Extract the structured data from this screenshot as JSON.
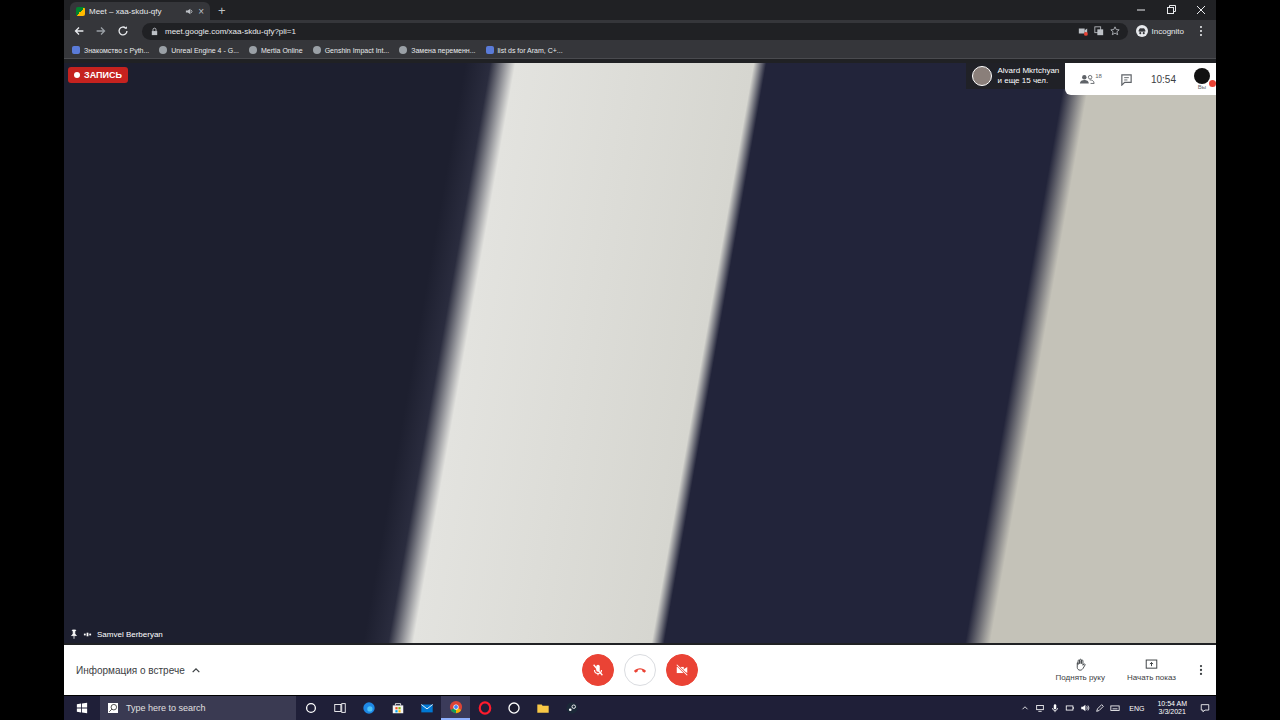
{
  "browser": {
    "tabs": [
      {
        "title": "Meet – xaa-skdu-qfy",
        "selected": true,
        "audio": true,
        "close": "×"
      }
    ],
    "new_tab": "+",
    "url": "meet.google.com/xaa-skdu-qfy?pli=1",
    "profile": "Incognito",
    "bookmarks": [
      "Знакомство с Pyth...",
      "Unreal Engine 4 - G...",
      "Mertia Online",
      "Genshin Impact Int...",
      "Замена переменн...",
      "list ds for Aram, C+..."
    ]
  },
  "meeting": {
    "recording": {
      "label": "ЗАПИСЬ",
      "on": true
    },
    "participants": {
      "name": "Alvard Mkrtchyan",
      "more": "и еще 15 чел.",
      "count": "18"
    },
    "time": "10:54",
    "self_label": "Вы",
    "speaker": {
      "name": "Samvel Berberyan",
      "pinned": true
    }
  },
  "toolbar": {
    "info": "Информация о встрече",
    "controls": [
      {
        "kind": "mic",
        "off": true
      },
      {
        "kind": "hangup",
        "off": false
      },
      {
        "kind": "camera",
        "off": true
      }
    ],
    "actions": [
      {
        "kind": "hand",
        "label": "Поднять руку"
      },
      {
        "kind": "present",
        "label": "Начать показ"
      }
    ]
  },
  "taskbar": {
    "search_placeholder": "Type here to search",
    "apps": [
      {
        "kind": "cortana",
        "active": false
      },
      {
        "kind": "taskview",
        "active": false
      },
      {
        "kind": "edge",
        "active": false
      },
      {
        "kind": "store",
        "active": false
      },
      {
        "kind": "mail",
        "active": false
      },
      {
        "kind": "chrome",
        "active": true
      },
      {
        "kind": "opera",
        "active": false
      },
      {
        "kind": "unreal",
        "active": false
      },
      {
        "kind": "explorer",
        "active": false
      },
      {
        "kind": "steam",
        "active": false
      }
    ],
    "language": "ENG",
    "time": "10:54 AM",
    "date": "3/3/2021"
  }
}
